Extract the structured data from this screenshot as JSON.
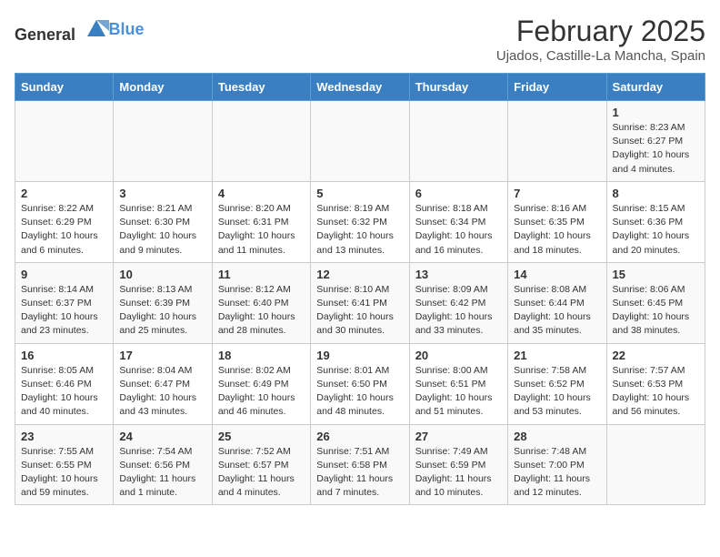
{
  "header": {
    "logo_general": "General",
    "logo_blue": "Blue",
    "title": "February 2025",
    "subtitle": "Ujados, Castille-La Mancha, Spain"
  },
  "days_of_week": [
    "Sunday",
    "Monday",
    "Tuesday",
    "Wednesday",
    "Thursday",
    "Friday",
    "Saturday"
  ],
  "weeks": [
    [
      {
        "day": "",
        "info": ""
      },
      {
        "day": "",
        "info": ""
      },
      {
        "day": "",
        "info": ""
      },
      {
        "day": "",
        "info": ""
      },
      {
        "day": "",
        "info": ""
      },
      {
        "day": "",
        "info": ""
      },
      {
        "day": "1",
        "info": "Sunrise: 8:23 AM\nSunset: 6:27 PM\nDaylight: 10 hours and 4 minutes."
      }
    ],
    [
      {
        "day": "2",
        "info": "Sunrise: 8:22 AM\nSunset: 6:29 PM\nDaylight: 10 hours and 6 minutes."
      },
      {
        "day": "3",
        "info": "Sunrise: 8:21 AM\nSunset: 6:30 PM\nDaylight: 10 hours and 9 minutes."
      },
      {
        "day": "4",
        "info": "Sunrise: 8:20 AM\nSunset: 6:31 PM\nDaylight: 10 hours and 11 minutes."
      },
      {
        "day": "5",
        "info": "Sunrise: 8:19 AM\nSunset: 6:32 PM\nDaylight: 10 hours and 13 minutes."
      },
      {
        "day": "6",
        "info": "Sunrise: 8:18 AM\nSunset: 6:34 PM\nDaylight: 10 hours and 16 minutes."
      },
      {
        "day": "7",
        "info": "Sunrise: 8:16 AM\nSunset: 6:35 PM\nDaylight: 10 hours and 18 minutes."
      },
      {
        "day": "8",
        "info": "Sunrise: 8:15 AM\nSunset: 6:36 PM\nDaylight: 10 hours and 20 minutes."
      }
    ],
    [
      {
        "day": "9",
        "info": "Sunrise: 8:14 AM\nSunset: 6:37 PM\nDaylight: 10 hours and 23 minutes."
      },
      {
        "day": "10",
        "info": "Sunrise: 8:13 AM\nSunset: 6:39 PM\nDaylight: 10 hours and 25 minutes."
      },
      {
        "day": "11",
        "info": "Sunrise: 8:12 AM\nSunset: 6:40 PM\nDaylight: 10 hours and 28 minutes."
      },
      {
        "day": "12",
        "info": "Sunrise: 8:10 AM\nSunset: 6:41 PM\nDaylight: 10 hours and 30 minutes."
      },
      {
        "day": "13",
        "info": "Sunrise: 8:09 AM\nSunset: 6:42 PM\nDaylight: 10 hours and 33 minutes."
      },
      {
        "day": "14",
        "info": "Sunrise: 8:08 AM\nSunset: 6:44 PM\nDaylight: 10 hours and 35 minutes."
      },
      {
        "day": "15",
        "info": "Sunrise: 8:06 AM\nSunset: 6:45 PM\nDaylight: 10 hours and 38 minutes."
      }
    ],
    [
      {
        "day": "16",
        "info": "Sunrise: 8:05 AM\nSunset: 6:46 PM\nDaylight: 10 hours and 40 minutes."
      },
      {
        "day": "17",
        "info": "Sunrise: 8:04 AM\nSunset: 6:47 PM\nDaylight: 10 hours and 43 minutes."
      },
      {
        "day": "18",
        "info": "Sunrise: 8:02 AM\nSunset: 6:49 PM\nDaylight: 10 hours and 46 minutes."
      },
      {
        "day": "19",
        "info": "Sunrise: 8:01 AM\nSunset: 6:50 PM\nDaylight: 10 hours and 48 minutes."
      },
      {
        "day": "20",
        "info": "Sunrise: 8:00 AM\nSunset: 6:51 PM\nDaylight: 10 hours and 51 minutes."
      },
      {
        "day": "21",
        "info": "Sunrise: 7:58 AM\nSunset: 6:52 PM\nDaylight: 10 hours and 53 minutes."
      },
      {
        "day": "22",
        "info": "Sunrise: 7:57 AM\nSunset: 6:53 PM\nDaylight: 10 hours and 56 minutes."
      }
    ],
    [
      {
        "day": "23",
        "info": "Sunrise: 7:55 AM\nSunset: 6:55 PM\nDaylight: 10 hours and 59 minutes."
      },
      {
        "day": "24",
        "info": "Sunrise: 7:54 AM\nSunset: 6:56 PM\nDaylight: 11 hours and 1 minute."
      },
      {
        "day": "25",
        "info": "Sunrise: 7:52 AM\nSunset: 6:57 PM\nDaylight: 11 hours and 4 minutes."
      },
      {
        "day": "26",
        "info": "Sunrise: 7:51 AM\nSunset: 6:58 PM\nDaylight: 11 hours and 7 minutes."
      },
      {
        "day": "27",
        "info": "Sunrise: 7:49 AM\nSunset: 6:59 PM\nDaylight: 11 hours and 10 minutes."
      },
      {
        "day": "28",
        "info": "Sunrise: 7:48 AM\nSunset: 7:00 PM\nDaylight: 11 hours and 12 minutes."
      },
      {
        "day": "",
        "info": ""
      }
    ]
  ]
}
